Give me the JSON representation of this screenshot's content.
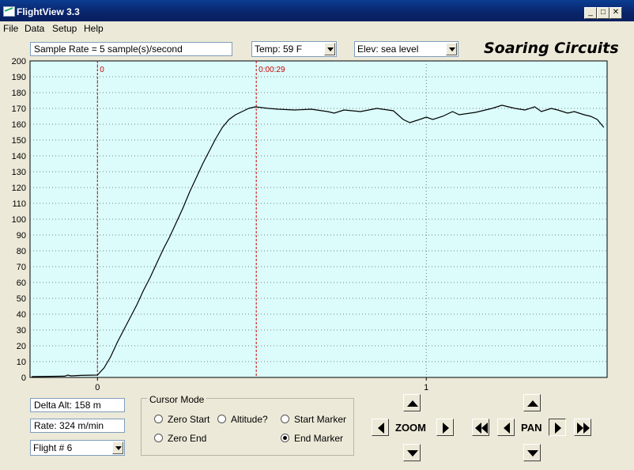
{
  "window": {
    "title": "FlightView 3.3",
    "minimize_label": "_",
    "maximize_label": "□",
    "close_label": "✕"
  },
  "menu": [
    "File",
    "Data",
    "Setup",
    "Help"
  ],
  "toolbar": {
    "sample_rate": "Sample Rate =  5 sample(s)/second",
    "temp": "Temp:  59 F",
    "elev": "Elev: sea level",
    "brand": "Soaring Circuits"
  },
  "chart_data": {
    "type": "line",
    "y_ticks": [
      0,
      10,
      20,
      30,
      40,
      50,
      60,
      70,
      80,
      90,
      100,
      110,
      120,
      130,
      140,
      150,
      160,
      170,
      180,
      190,
      200
    ],
    "ylim": [
      0,
      200
    ],
    "x_ticks": [
      {
        "value": 0,
        "label": "0"
      },
      {
        "value": 1,
        "label": "1"
      }
    ],
    "xlim": [
      -0.205,
      1.55
    ],
    "grid": true,
    "background": "#dcfcfc",
    "line_color": "#000000",
    "marker_color": "#cc0000",
    "markers": [
      {
        "x": 0,
        "label": "0"
      },
      {
        "x": 0.483,
        "label": "0:00:29"
      }
    ],
    "series": [
      {
        "x": [
          -0.2,
          -0.1,
          -0.09,
          -0.08,
          -0.05,
          0,
          0.02,
          0.04,
          0.06,
          0.08,
          0.1,
          0.12,
          0.14,
          0.16,
          0.18,
          0.2,
          0.22,
          0.24,
          0.26,
          0.28,
          0.3,
          0.32,
          0.34,
          0.36,
          0.38,
          0.4,
          0.42,
          0.44,
          0.46,
          0.48,
          0.5,
          0.52,
          0.55,
          0.6,
          0.65,
          0.7,
          0.72,
          0.75,
          0.8,
          0.85,
          0.9,
          0.93,
          0.95,
          0.98,
          1.0,
          1.02,
          1.05,
          1.08,
          1.1,
          1.15,
          1.2,
          1.23,
          1.25,
          1.27,
          1.3,
          1.33,
          1.35,
          1.38,
          1.4,
          1.43,
          1.45,
          1.48,
          1.5,
          1.52,
          1.54
        ],
        "y": [
          0.5,
          0.8,
          1.5,
          1,
          1.3,
          1.5,
          6,
          13,
          22,
          30,
          38,
          46,
          55,
          63,
          72,
          81,
          89,
          98,
          107,
          117,
          126,
          135,
          143,
          151,
          158,
          163,
          166,
          168,
          170,
          171,
          170.5,
          170,
          169.5,
          169,
          169.5,
          168,
          167,
          169,
          168,
          170,
          168.5,
          163,
          161,
          163,
          164.5,
          163,
          165,
          168,
          166,
          167.5,
          170,
          172,
          171,
          170,
          169,
          171,
          168,
          170,
          169,
          167,
          168,
          166,
          165,
          163,
          158
        ]
      }
    ]
  },
  "stats": {
    "delta_alt": "Delta Alt: 158 m",
    "rate": "Rate: 324 m/min",
    "flight": "Flight # 6"
  },
  "cursor_mode": {
    "title": "Cursor Mode",
    "options": [
      {
        "label": "Zero Start",
        "selected": false
      },
      {
        "label": "Altitude?",
        "selected": false
      },
      {
        "label": "Start Marker",
        "selected": false
      },
      {
        "label": "Zero End",
        "selected": false
      },
      {
        "label": "End Marker",
        "selected": true
      }
    ]
  },
  "zoom": {
    "label": "ZOOM"
  },
  "pan": {
    "label": "PAN"
  }
}
